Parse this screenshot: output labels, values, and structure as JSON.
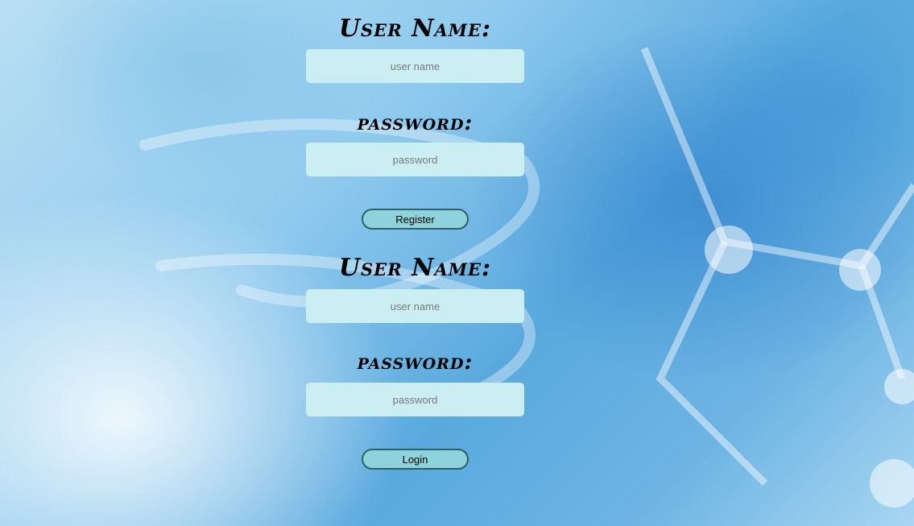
{
  "register_form": {
    "username_label": "User Name:",
    "username_placeholder": "user name",
    "password_label": "password:",
    "password_placeholder": "password",
    "submit_label": "Register"
  },
  "login_form": {
    "username_label": "User Name:",
    "username_placeholder": "user name",
    "password_label": "password:",
    "password_placeholder": "password",
    "submit_label": "Login"
  },
  "colors": {
    "field_background": "#cbeef2",
    "button_background": "#8ed3dc",
    "button_border": "#2f5f69"
  }
}
